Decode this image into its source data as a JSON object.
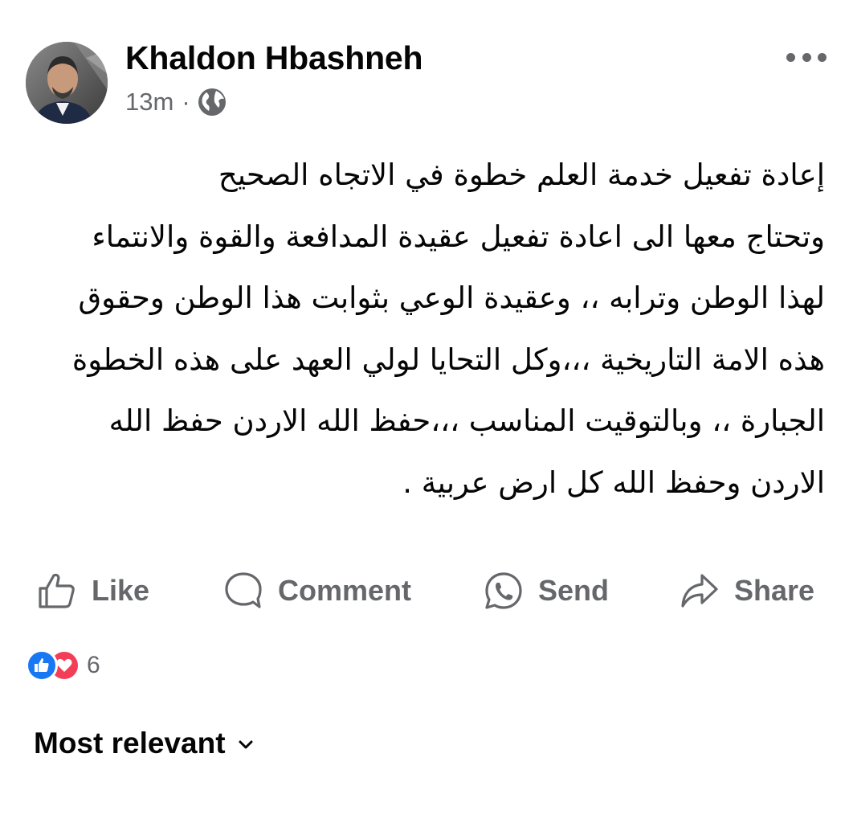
{
  "post": {
    "author": "Khaldon Hbashneh",
    "time": "13m",
    "separator": "·",
    "privacy_icon": "globe-icon",
    "body_lines": [
      "إعادة تفعيل خدمة العلم خطوة في الاتجاه الصحيح",
      "وتحتاج معها الى اعادة تفعيل  عقيدة  المدافعة والقوة والانتماء",
      "لهذا الوطن وترابه ،، وعقيدة الوعي بثوابت هذا الوطن  وحقوق",
      "هذه الامة التاريخية ،،،وكل التحايا لولي العهد على هذه الخطوة",
      "الجبارة ،، وبالتوقيت المناسب ،،،حفظ الله الاردن  حفظ الله",
      "الاردن وحفظ الله كل ارض  عربية ."
    ]
  },
  "actions": {
    "like": "Like",
    "comment": "Comment",
    "send": "Send",
    "share": "Share"
  },
  "reactions": {
    "types": [
      "like-icon",
      "love-icon"
    ],
    "count": "6"
  },
  "comments": {
    "sort_label": "Most relevant"
  },
  "colors": {
    "text": "#050505",
    "secondary": "#65676b",
    "like_blue": "#1877f2",
    "love_red": "#f33e58"
  }
}
